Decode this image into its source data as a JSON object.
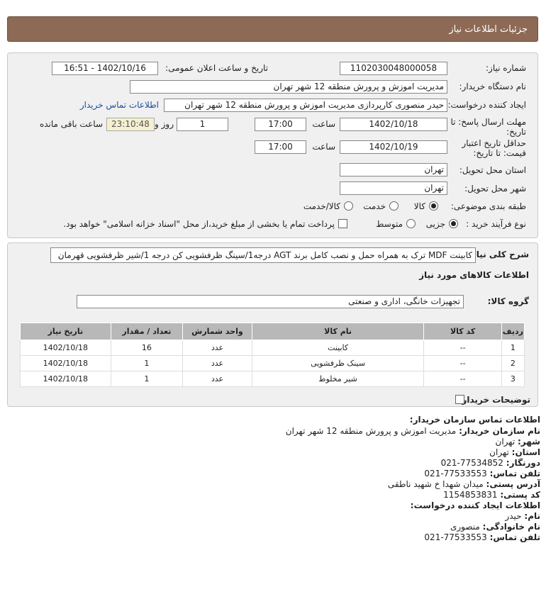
{
  "header": {
    "title": "جزئیات اطلاعات نیاز"
  },
  "form": {
    "need_number": {
      "label": "شماره نیاز:",
      "value": "1102030048000058"
    },
    "announce": {
      "label": "تاریخ و ساعت اعلان عمومی:",
      "value": "1402/10/16 - 16:51"
    },
    "buyer_org": {
      "label": "نام دستگاه خریدار:",
      "value": "مدیریت اموزش و پرورش منطقه 12 شهر تهران"
    },
    "requester": {
      "label": "ایجاد کننده درخواست:",
      "value": "حیدر منصوری کارپردازی مدیریت اموزش و پرورش منطقه 12 شهر تهران",
      "link": "اطلاعات تماس خریدار"
    },
    "deadline": {
      "label_line1": "مهلت ارسال پاسخ: تا",
      "label_line2": "تاریخ:",
      "date": "1402/10/18",
      "time_label": "ساعت",
      "time": "17:00",
      "days": "1",
      "days_label": "روز و",
      "remaining": "23:10:48",
      "remaining_label": "ساعت باقی مانده"
    },
    "validity": {
      "label_line1": "حداقل تاریخ اعتبار",
      "label_line2": "قیمت: تا تاریخ:",
      "date": "1402/10/19",
      "time_label": "ساعت",
      "time": "17:00"
    },
    "province": {
      "label": "استان محل تحویل:",
      "value": "تهران"
    },
    "city": {
      "label": "شهر محل تحویل:",
      "value": "تهران"
    },
    "category": {
      "label": "طبقه بندی موضوعی:",
      "options": [
        "کالا",
        "خدمت",
        "کالا/خدمت"
      ],
      "selected": "کالا"
    },
    "process": {
      "label": "نوع فرآیند خرید :",
      "options": [
        "جزیی",
        "متوسط"
      ],
      "selected": "جزیی",
      "treasury_note": "پرداخت تمام یا بخشی از مبلغ خرید،از محل \"اسناد خزانه اسلامی\" خواهد بود."
    }
  },
  "summary": {
    "label": "شرح کلی نیاز:",
    "value": "کابینت MDF ترک به همراه حمل و نصب کامل برند AGT درجه1/سینگ ظرفشویی کن درجه 1/شیر ظرفشویی قهرمان",
    "items_title": "اطلاعات کالاهای مورد نیاز",
    "group_label": "گروه کالا:",
    "group_value": "تجهیزات خانگی، اداری و صنعتی"
  },
  "table": {
    "headers": [
      "ردیف",
      "کد کالا",
      "نام کالا",
      "واحد شمارش",
      "تعداد / مقدار",
      "تاریخ نیاز"
    ],
    "rows": [
      [
        "1",
        "--",
        "کابینت",
        "عدد",
        "16",
        "1402/10/18"
      ],
      [
        "2",
        "--",
        "سینک ظرفشویی",
        "عدد",
        "1",
        "1402/10/18"
      ],
      [
        "3",
        "--",
        "شیر مخلوط",
        "عدد",
        "1",
        "1402/10/18"
      ]
    ]
  },
  "buyer_notes": {
    "label": "توضیحات خریدار:"
  },
  "contact": {
    "title": "اطلاعات تماس سازمان خریدار:",
    "org_label": "نام سازمان خریدار:",
    "org": "مدیریت اموزش و پرورش منطقه 12 شهر تهران",
    "city_label": "شهر:",
    "city": "تهران",
    "province_label": "استان:",
    "province": "تهران",
    "fax_label": "دورنگار:",
    "fax": "021-77534852",
    "phone_label": "تلفن تماس:",
    "phone": "021-77533553",
    "address_label": "آدرس پستی:",
    "address": "میدان شهدا خ شهید ناطقی",
    "postal_label": "کد پستی:",
    "postal": "1154853831",
    "creator_title": "اطلاعات ایجاد کننده درخواست:",
    "name_label": "نام:",
    "name": "حیدر",
    "family_label": "نام خانوادگی:",
    "family": "منصوری",
    "creator_phone_label": "تلفن تماس:",
    "creator_phone": "021-77533553"
  },
  "colors": {
    "title_bar": "#8d6a55",
    "panel": "#f0f0f0",
    "table_header": "#b8b8b8",
    "link": "#1a4fa0",
    "countdown": "#f5f0cf"
  }
}
